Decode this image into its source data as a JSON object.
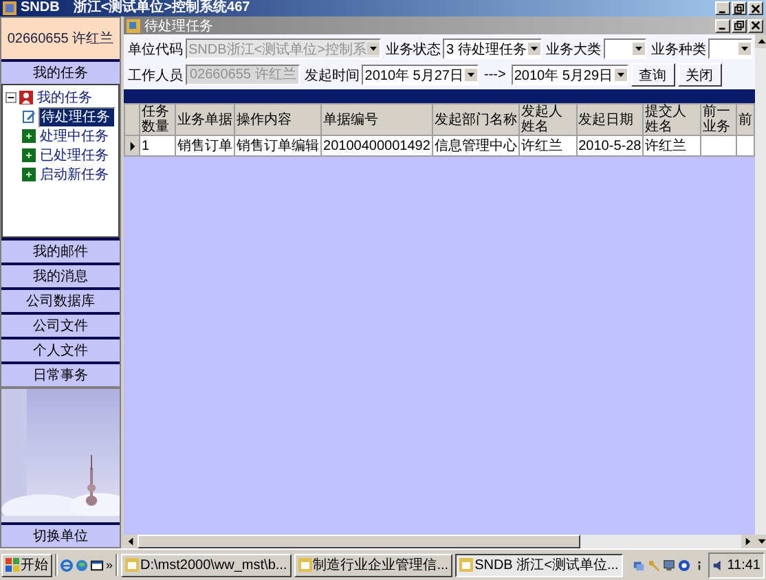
{
  "window": {
    "title": "SNDB　浙江<测试单位>控制系统467"
  },
  "sidebar": {
    "user": "02660655 许红兰",
    "section": "我的任务",
    "tree": {
      "label": "我的任务",
      "expanded": true,
      "children": [
        {
          "label": "待处理任务",
          "selected": true
        },
        {
          "label": "处理中任务",
          "selected": false
        },
        {
          "label": "已处理任务",
          "selected": false
        },
        {
          "label": "启动新任务",
          "selected": false
        }
      ]
    },
    "nav_buttons": [
      "我的邮件",
      "我的消息",
      "公司数据库",
      "公司文件",
      "个人文件",
      "日常事务"
    ],
    "switch_button": "切换单位"
  },
  "task_window": {
    "title": "待处理任务",
    "form_rows": [
      [
        {
          "kind": "select",
          "label": "单位代码",
          "value": "SNDB浙江<测试单位>控制系",
          "disabled": true
        },
        {
          "kind": "select",
          "label": "业务状态",
          "value": "3 待处理任务",
          "disabled": false
        },
        {
          "kind": "select",
          "label": "业务大类",
          "disabled": false
        },
        {
          "kind": "select",
          "label": "业务种类",
          "disabled": false
        }
      ],
      [
        {
          "kind": "input",
          "label": "工作人员",
          "value": "02660655 许红兰",
          "disabled": true
        },
        {
          "kind": "date",
          "label": "发起时间",
          "value": "2010年 5月27日"
        },
        {
          "kind": "text",
          "value": "--->"
        },
        {
          "kind": "date",
          "value": "2010年 5月29日"
        },
        {
          "kind": "button",
          "value": "查询"
        },
        {
          "kind": "button",
          "value": "关闭"
        }
      ]
    ],
    "grid": {
      "columns": [
        "任务数量",
        "业务单据",
        "操作内容",
        "单据编号",
        "发起部门名称",
        "发起人姓名",
        "发起日期",
        "提交人姓名",
        "前一业务",
        "前"
      ],
      "rows": [
        {
          "current": true,
          "cells": [
            "1",
            "销售订单",
            "销售订单编辑",
            "20100400001492",
            "信息管理中心",
            "许红兰",
            "2010-5-28",
            "许红兰"
          ]
        }
      ]
    }
  },
  "taskbar": {
    "start": "开始",
    "overflow": "»",
    "tasks": [
      {
        "label": "D:\\mst2000\\ww_mst\\b...",
        "selected": false
      },
      {
        "label": "制造行业企业管理信...",
        "selected": false
      },
      {
        "label": "SNDB 浙江<测试单位...",
        "selected": true
      }
    ],
    "clock": "11:41"
  }
}
